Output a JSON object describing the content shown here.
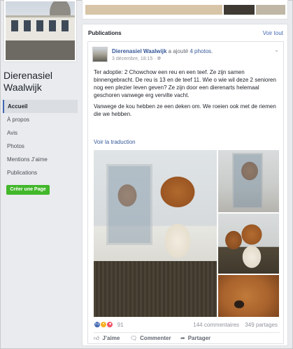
{
  "sidebar": {
    "page_name": "Dierenasiel Waalwijk",
    "nav": [
      {
        "label": "Accueil",
        "active": true
      },
      {
        "label": "À propos",
        "active": false
      },
      {
        "label": "Avis",
        "active": false
      },
      {
        "label": "Photos",
        "active": false
      },
      {
        "label": "Mentions J’aime",
        "active": false
      },
      {
        "label": "Publications",
        "active": false
      }
    ],
    "create_page_label": "Créer une Page"
  },
  "publications": {
    "title": "Publications",
    "see_all": "Voir tout"
  },
  "post": {
    "author": "Dierenasiel Waalwijk",
    "action_text": "a ajouté",
    "action_link": "4 photos",
    "action_end": ".",
    "timestamp": "3 décembre, 18:15 ·",
    "audience_icon": "globe-icon",
    "text_p1": "Ter adoptie: 2 Chowchow een reu en een teef. Ze zijn samen binnengebracht. De reu is 13 en de teef 11. Wie o wie wil deze 2 senioren nog een plezier leven geven? Ze zijn door een dierenarts helemaal geschoren vanwege erg vervilte vacht.",
    "text_p2": "Vanwege de kou hebben ze een deken om. We roeien ook met de riemen die we hebben.",
    "translate_label": "Voir la traduction",
    "reactions": [
      "like",
      "wow",
      "love"
    ],
    "reaction_count": "91",
    "comments": "144 commentaires",
    "shares": "349 partages",
    "actions": {
      "like": "J’aime",
      "comment": "Commenter",
      "share": "Partager"
    }
  },
  "colors": {
    "link": "#365899",
    "accent": "#4267b2",
    "create_button": "#42b72a",
    "background": "#e9ebee"
  }
}
